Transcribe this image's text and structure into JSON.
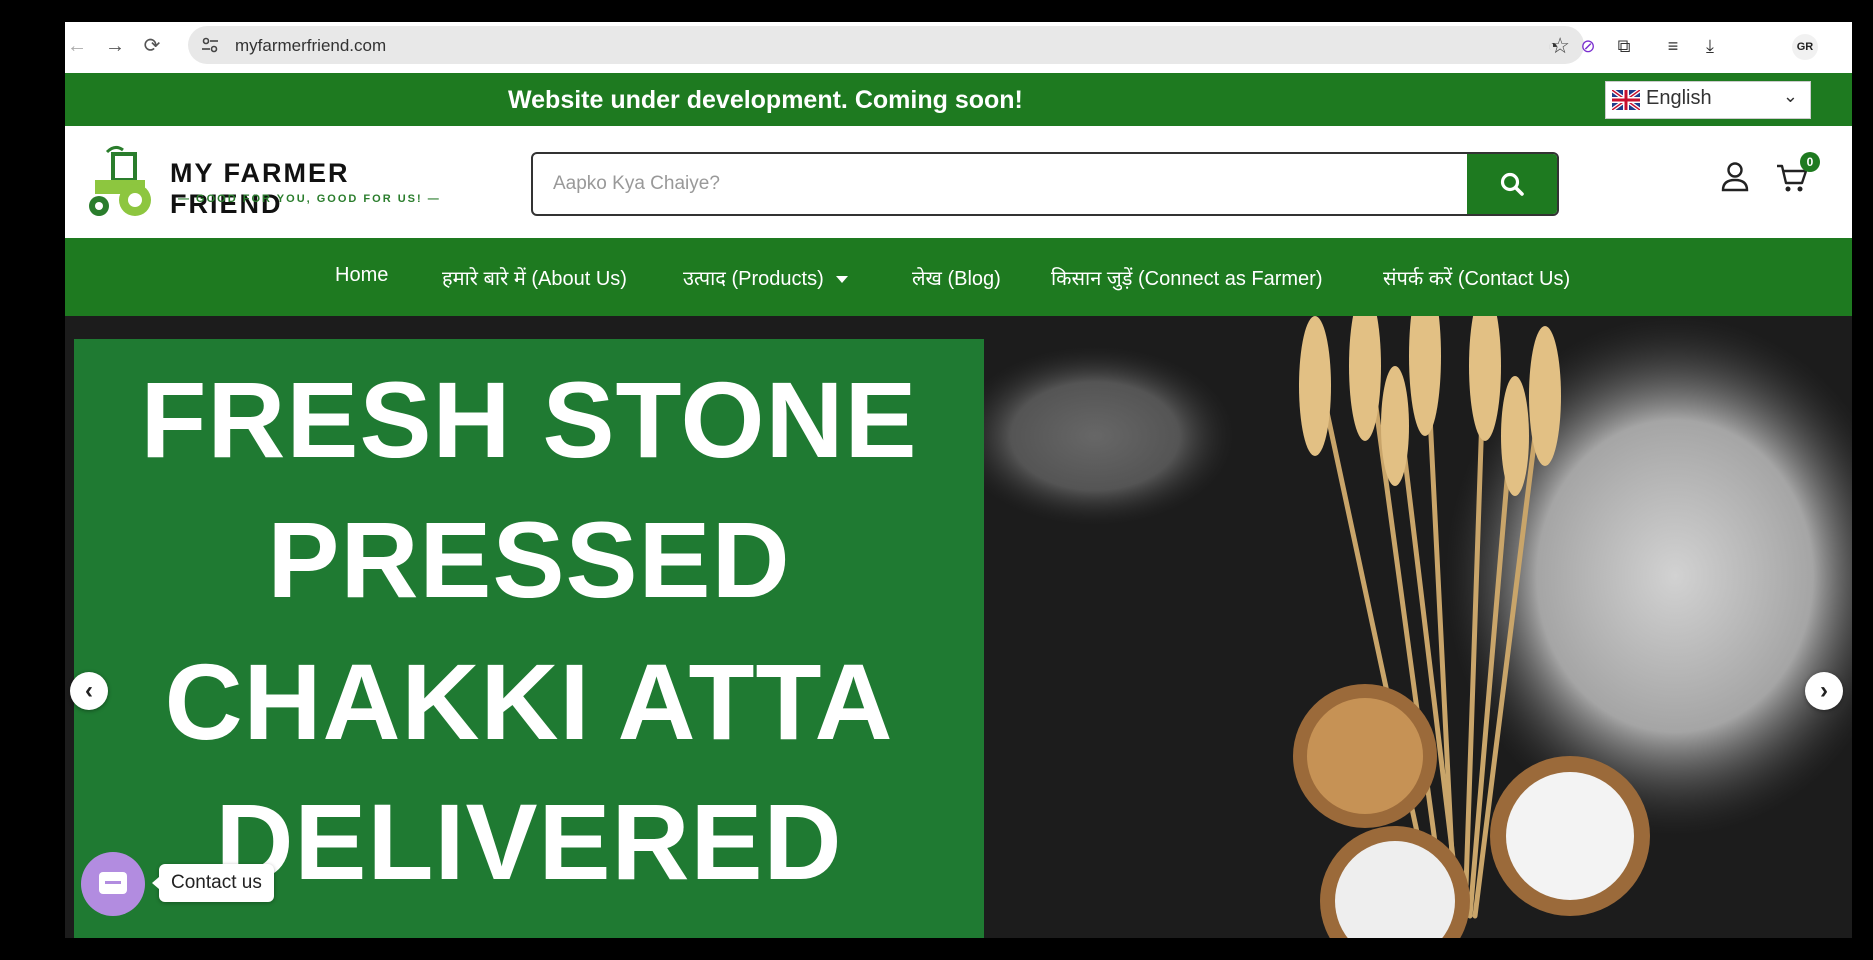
{
  "browser": {
    "url": "myfarmerfriend.com",
    "profile_initials": "GR"
  },
  "announcement": {
    "text": "Website under development. Coming soon!",
    "language": "English"
  },
  "header": {
    "brand": "MY FARMER FRIEND",
    "tagline": "— GOOD FOR YOU, GOOD FOR US! —",
    "search_placeholder": "Aapko Kya Chaiye?",
    "cart_count": "0"
  },
  "nav": {
    "items": [
      "Home",
      "हमारे बारे में (About Us)",
      "उत्पाद (Products)",
      "लेख (Blog)",
      "किसान जुड़ें (Connect as Farmer)",
      "संपर्क करें (Contact Us)"
    ]
  },
  "hero": {
    "lines": [
      "FRESH STONE",
      "PRESSED",
      "CHAKKI ATTA",
      "DELIVERED"
    ]
  },
  "contact_widget": {
    "label": "Contact us"
  },
  "colors": {
    "brand_green": "#1e7a20",
    "hero_green": "#1f7a32",
    "widget_purple": "#b28ce0"
  }
}
